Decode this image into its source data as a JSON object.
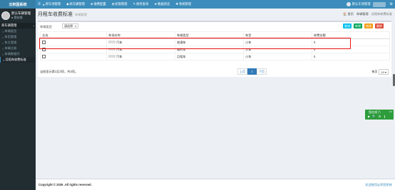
{
  "app": {
    "logo": "云积国系统"
  },
  "user": {
    "name": "默认车辆管理",
    "status": "● 您在线"
  },
  "sidebar": {
    "header": "商车辆管理",
    "items": [
      {
        "label": "车辆类型"
      },
      {
        "label": "车型管理"
      },
      {
        "label": "车主管理"
      },
      {
        "label": "车辆注册"
      },
      {
        "label": "车辆数据列"
      },
      {
        "label": "月租车收费标准",
        "active": true
      }
    ]
  },
  "topnav": {
    "menu_icon": "≡",
    "items": [
      {
        "label": "停车场管理",
        "icon": "●"
      },
      {
        "label": "商车辆管理",
        "icon": "◆"
      },
      {
        "label": "收费配置",
        "icon": "⊕"
      },
      {
        "label": "权限管理",
        "icon": "⊞"
      },
      {
        "label": "财务查询",
        "icon": "✎"
      },
      {
        "label": "数据状态",
        "icon": "★"
      },
      {
        "label": "系统管理",
        "icon": "✚"
      }
    ],
    "user_name": "默认车场管理",
    "gear": "⚙"
  },
  "header": {
    "title": "月租车收费标准",
    "subtitle": "车辆管理",
    "breadcrumbs": [
      "🏠 首页",
      "车辆管理",
      "月租车收费标准"
    ]
  },
  "toolbar": {
    "search_label": "车辆类型",
    "search_value": "请选择",
    "query": "查询",
    "add": "新增",
    "edit": "修改",
    "delete": "删除"
  },
  "table": {
    "columns": [
      "全选",
      "车场名称",
      "车辆类型",
      "车型",
      "收费金额"
    ],
    "rows": [
      {
        "lot_suffix": "汽车",
        "vehicle_type": "普通车",
        "model": "小车",
        "fee": "0"
      },
      {
        "lot_suffix": "汽车",
        "vehicle_type": "临时车",
        "model": "大车",
        "fee": "0"
      },
      {
        "lot_suffix": "汽车",
        "vehicle_type": "月租车",
        "model": "小车",
        "fee": "0"
      }
    ]
  },
  "pagination": {
    "info": "当前显示第1至3项，共3项。",
    "prev": "上页",
    "current": "1",
    "next": "下页",
    "per_page_label": "每页",
    "per_page": "10"
  },
  "float_widget": {
    "label": "您在线了!",
    "icons": "▶ 🔍 ⚙ ❙",
    "dots": "•••"
  },
  "footer": {
    "copyright": "Copyright © 2026 .All rights reserved.",
    "right": "欢迎使用云积国系统"
  }
}
